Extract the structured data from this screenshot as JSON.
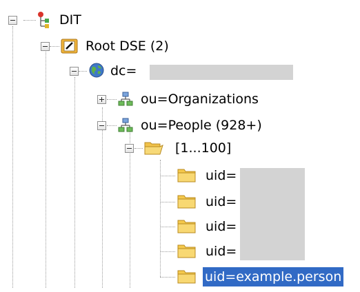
{
  "tree": {
    "root": {
      "label": "DIT"
    },
    "root_dse": {
      "label": "Root DSE (2)"
    },
    "dc": {
      "label": "dc="
    },
    "ou_organizations": {
      "label": "ou=Organizations"
    },
    "ou_people": {
      "label": "ou=People (928+)"
    },
    "range": {
      "label": "[1...100]"
    },
    "entries": [
      {
        "label": "uid="
      },
      {
        "label": "uid="
      },
      {
        "label": "uid="
      },
      {
        "label": "uid="
      },
      {
        "label": "uid=example.person"
      }
    ]
  },
  "colors": {
    "selection": "#316ac5",
    "folder": "#f5c94c",
    "redaction": "#d3d3d3"
  },
  "icons": {
    "root": "dit-tree-icon",
    "root_dse": "root-dse-icon",
    "dc": "globe-icon",
    "ou": "org-unit-icon",
    "range": "open-folder-icon",
    "entry": "folder-icon"
  }
}
